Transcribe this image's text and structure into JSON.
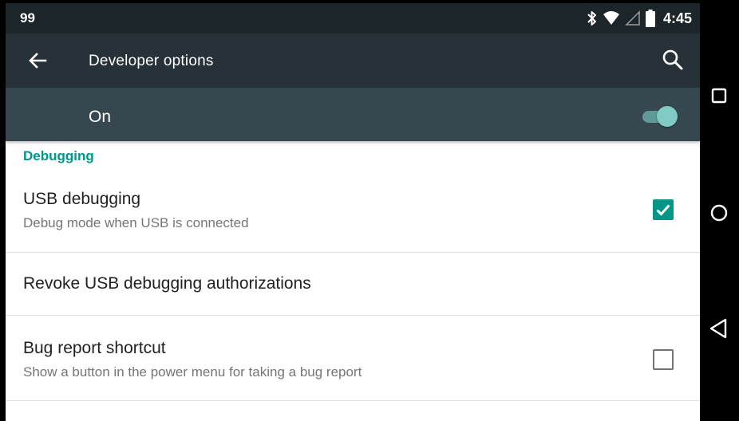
{
  "status_bar": {
    "notification_count": "99",
    "time": "4:45",
    "icons": [
      "bluetooth-icon",
      "wifi-icon",
      "signal-icon",
      "battery-icon"
    ]
  },
  "toolbar": {
    "title": "Developer options",
    "back_icon": "arrow-back-icon",
    "search_icon": "search-icon"
  },
  "master_switch": {
    "label": "On",
    "state": true
  },
  "section": {
    "header": "Debugging"
  },
  "preferences": [
    {
      "title": "USB debugging",
      "summary": "Debug mode when USB is connected",
      "checked": true
    },
    {
      "title": "Revoke USB debugging authorizations"
    },
    {
      "title": "Bug report shortcut",
      "summary": "Show a button in the power menu for taking a bug report",
      "checked": false
    }
  ],
  "nav_bar": {
    "buttons": [
      "recents-icon",
      "home-icon",
      "back-icon"
    ]
  },
  "colors": {
    "status_bar": "#1c2529",
    "toolbar": "#263238",
    "switch_bar": "#37474f",
    "accent": "#009688",
    "toggle_thumb": "#80cbc4"
  }
}
